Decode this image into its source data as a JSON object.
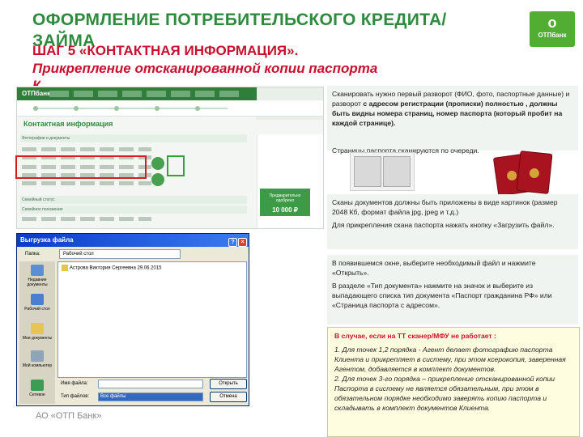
{
  "header": {
    "title": "ОФОРМЛЕНИЕ ПОТРЕБИТЕЛЬСКОГО КРЕДИТА/ЗАЙМА",
    "step": "ШАГ 5 «КОНТАКТНАЯ ИНФОРМАЦИЯ».",
    "subtitle": "Прикрепление отсканированной копии паспорта",
    "subtitle_tail": "К"
  },
  "logo": {
    "mark": "o",
    "text": "ОТПбанк"
  },
  "bank_screen": {
    "logo": "ОТПбанк",
    "heading": "Контактная информация",
    "section1": "Фотографии и документы",
    "section2": "Семейный статус",
    "section3": "Семейное положение",
    "badge_label": "Предварительно одобрено",
    "badge_amount": "10 000 ₽"
  },
  "dialog": {
    "title": "Выгрузка файла",
    "folder_label": "Папка:",
    "folder_value": "Рабочий стол",
    "file_item": "Астрова Виктория Сергеевна 29.06.2015",
    "places": [
      "Недавние документы",
      "Рабочий стол",
      "Мои документы",
      "Мой компьютер",
      "Сетевое"
    ],
    "filename_label": "Имя файла:",
    "filetype_label": "Тип файлов:",
    "filetype_value": "Все файлы",
    "open_button": "Открыть",
    "cancel_button": "Отмена"
  },
  "box1": {
    "text_a": "Сканировать нужно первый разворот   (ФИО, фото, паспортные данные) и разворот ",
    "text_b": "с адресом регистрации (прописки) полностью , должны быть видны номера страниц,  номер паспорта (который пробит на каждой странице).",
    "tail": "Страницы паспорта сканируются по очереди."
  },
  "box2": {
    "p1": "Сканы документов должны быть приложены в виде картинок (размер 2048 Кб, формат файла jpg, jpeg и т.д.)",
    "p2": "Для прикрепления скана паспорта нажать кнопку «Загрузить файл»."
  },
  "box3": {
    "p1": "В появившемся окне, выберите необходимый файл и нажмите «Открыть».",
    "p2": "В разделе «Тип документа» нажмите на значок     и выберите из выпадающего списка тип документа «Паспорт гражданина РФ» или «Страница паспорта с адресом»."
  },
  "note": {
    "head": "В случае, если на ТТ сканер/МФУ не работает :",
    "p1": "1. Для точек 1,2 порядка - Агент делает фотографию паспорта Клиента и прикрепляет в систему, при этом ксерокопия, заверенная Агентом, добавляется в комплект документов.",
    "p2": "2.  Для точек 3-го порядка – прикрепление отсканированной копии Паспорта в систему не является обязательным, при этом в обязательном порядке необходимо заверять копию паспорта и складывать в комплект документов Клиента."
  },
  "footer": "АО «ОТП Банк»"
}
